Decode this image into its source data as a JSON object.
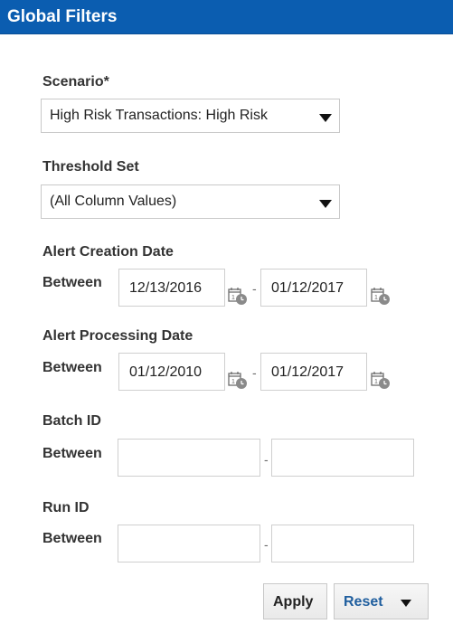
{
  "header": {
    "title": "Global Filters"
  },
  "scenario": {
    "label": "Scenario*",
    "value": "High Risk Transactions: High Risk"
  },
  "threshold_set": {
    "label": "Threshold Set",
    "value": "(All Column Values)"
  },
  "alert_creation_date": {
    "label": "Alert Creation Date",
    "between_label": "Between",
    "from": "12/13/2016",
    "to": "01/12/2017",
    "separator": "-"
  },
  "alert_processing_date": {
    "label": "Alert Processing Date",
    "between_label": "Between",
    "from": "01/12/2010",
    "to": "01/12/2017",
    "separator": "-"
  },
  "batch_id": {
    "label": "Batch ID",
    "between_label": "Between",
    "from": "",
    "to": "",
    "separator": "-"
  },
  "run_id": {
    "label": "Run ID",
    "between_label": "Between",
    "from": "",
    "to": "",
    "separator": "-"
  },
  "buttons": {
    "apply": "Apply",
    "reset": "Reset"
  },
  "icons": {
    "calendar": "calendar-icon",
    "dropdown": "chevron-down-icon"
  },
  "colors": {
    "header_bg": "#0b5db0",
    "header_text": "#ffffff",
    "reset_text": "#1f5e9e"
  }
}
